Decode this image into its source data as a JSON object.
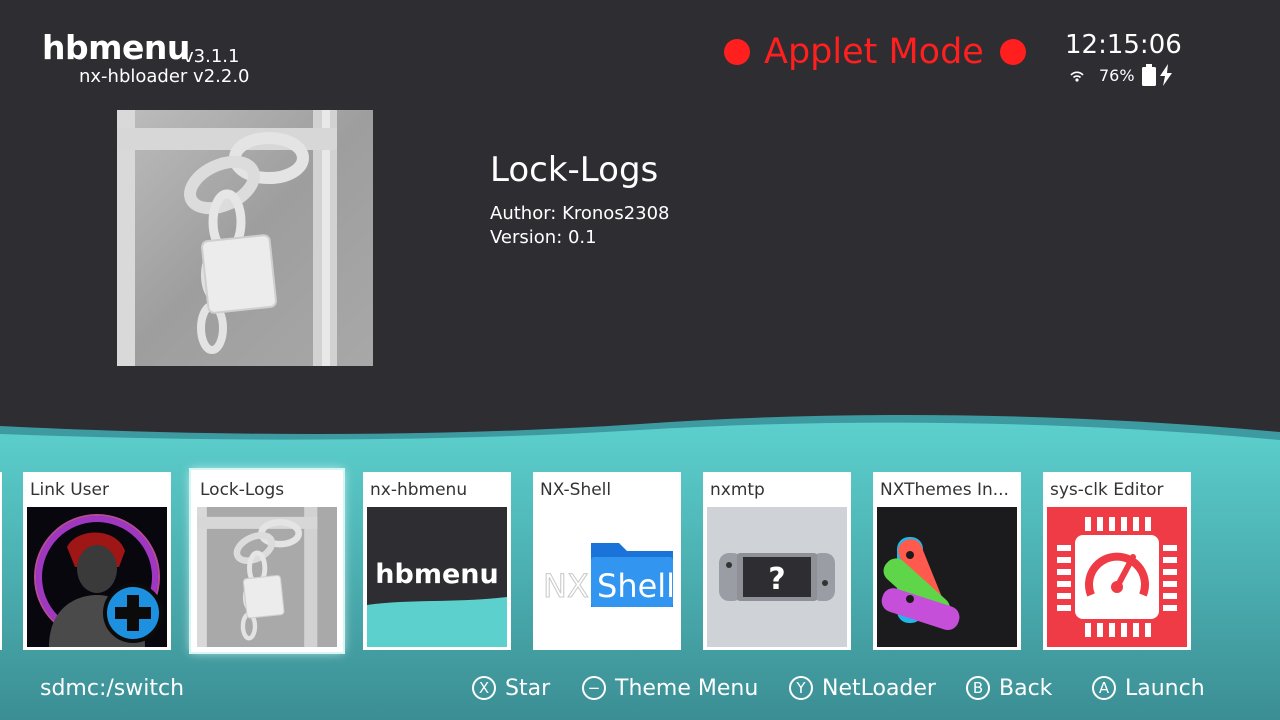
{
  "header": {
    "app_name": "hbmenu",
    "app_version": "v3.1.1",
    "loader_version": "nx-hbloader v2.2.0",
    "mode_label": "Applet Mode",
    "clock": "12:15:06",
    "battery": "76%"
  },
  "selected": {
    "title": "Lock-Logs",
    "author": "Author: Kronos2308",
    "version": "Version: 0.1"
  },
  "tiles": [
    {
      "label": "Link User",
      "icon": "link-user-icon"
    },
    {
      "label": "Lock-Logs",
      "icon": "padlock-chain-icon"
    },
    {
      "label": "nx-hbmenu",
      "icon": "hbmenu-logo-icon",
      "logo_text": "hbmenu"
    },
    {
      "label": "NX-Shell",
      "icon": "folder-icon",
      "logo_text_a": "NX",
      "logo_text_b": "Shell"
    },
    {
      "label": "nxmtp",
      "icon": "switch-console-icon",
      "logo_text": "?"
    },
    {
      "label": "NXThemes In...",
      "icon": "joycon-fan-icon"
    },
    {
      "label": "sys-clk Editor",
      "icon": "cpu-gauge-icon"
    }
  ],
  "footer": {
    "path": "sdmc:/switch",
    "hints": [
      {
        "button": "X",
        "label": "Star"
      },
      {
        "button": "−",
        "label": "Theme Menu"
      },
      {
        "button": "Y",
        "label": "NetLoader"
      },
      {
        "button": "B",
        "label": "Back"
      },
      {
        "button": "A",
        "label": "Launch"
      }
    ]
  },
  "colors": {
    "background": "#2d2d32",
    "accent_teal": "#57c8c6",
    "applet_red": "#ff1f1f"
  }
}
